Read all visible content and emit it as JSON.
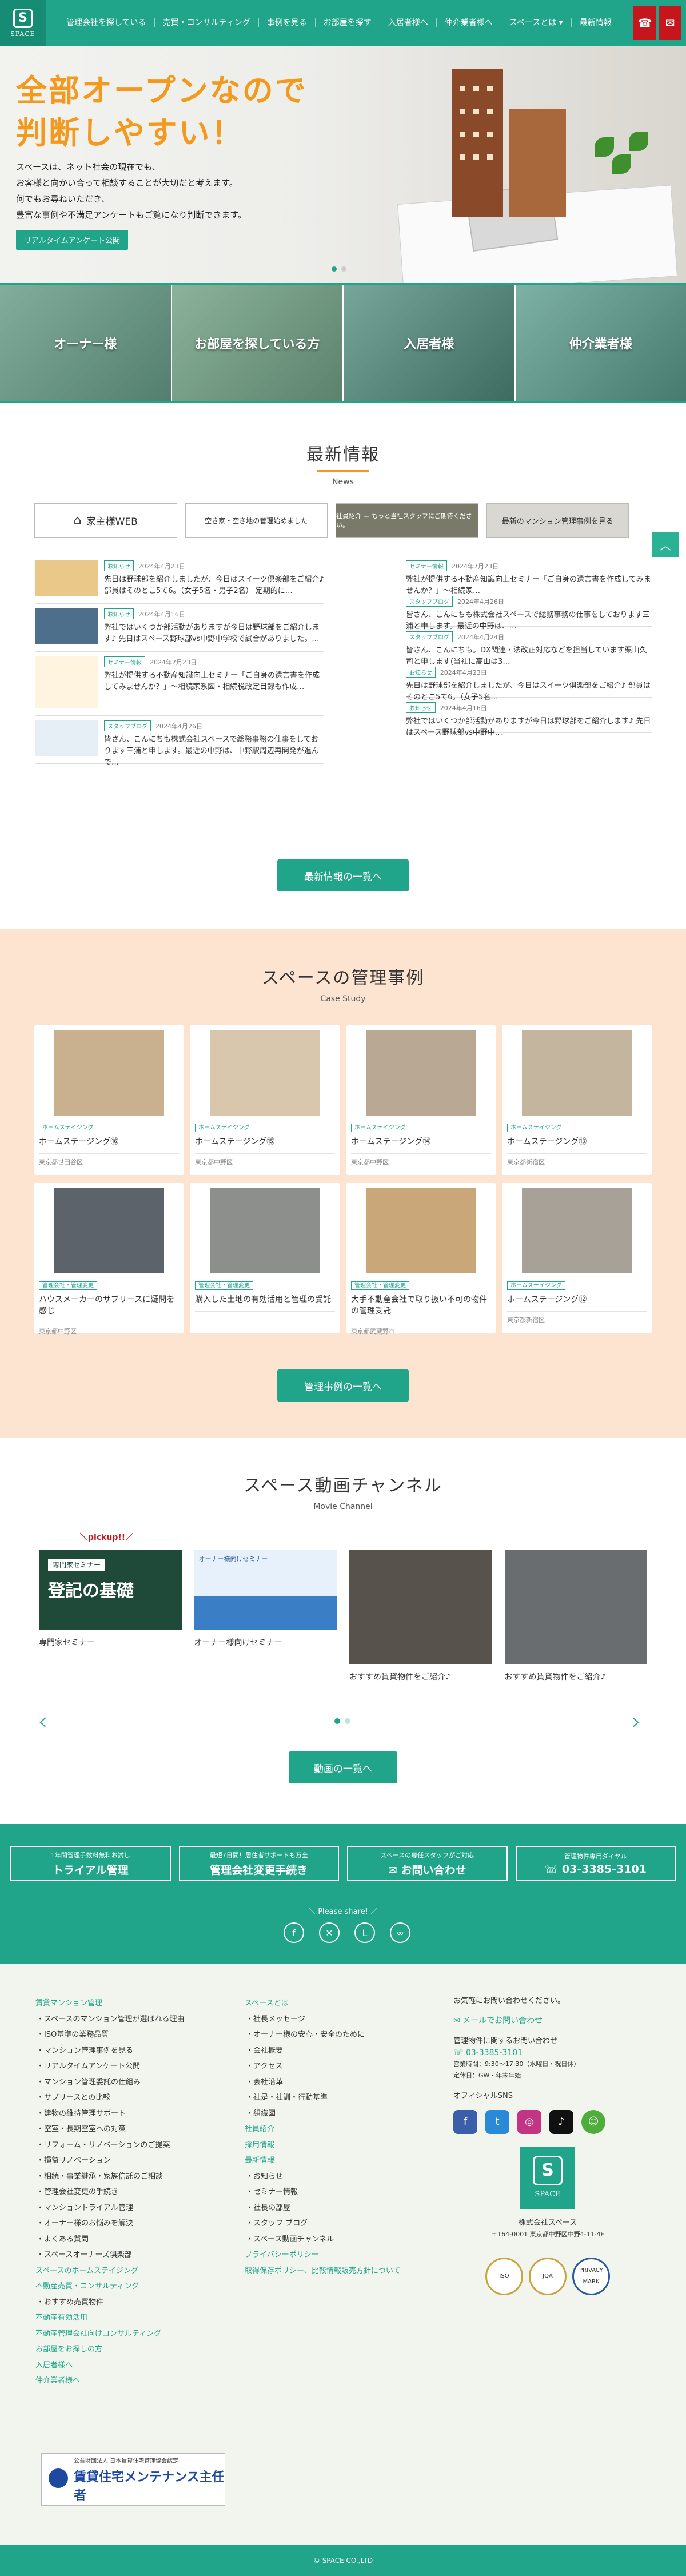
{
  "header": {
    "logo_text": "SPACE",
    "logo_mark": "S",
    "nav": [
      "管理会社を探している",
      "売買・コンサルティング",
      "事例を見る",
      "お部屋を探す",
      "入居者様へ",
      "仲介業者様へ",
      "スペースとは ▾",
      "最新情報"
    ],
    "icons": [
      "phone-icon",
      "mail-icon"
    ]
  },
  "hero": {
    "title_line1": "全部オープンなので",
    "title_line2": "判断しやすい！",
    "desc": [
      "スペースは、ネット社会の現在でも、",
      "お客様と向かい合って相談することが大切だと考えます。",
      "何でもお尋ねいただき、",
      "豊富な事例や不満足アンケートもご覧になり判断できます。"
    ],
    "cta": "リアルタイムアンケート公開"
  },
  "audience": [
    "オーナー様",
    "お部屋を探している方",
    "入居者様",
    "仲介業者様"
  ],
  "news": {
    "title": "最新情報",
    "subtitle": "News",
    "banners": [
      "家主様WEB",
      "空き家・空き地の管理始めました",
      "社員紹介 — もっと当社スタッフにご期待ください。",
      "最新のマンション管理事例を見る"
    ],
    "left": [
      {
        "tag": "お知らせ",
        "date": "2024年4月23日",
        "text": "先日は野球部を紹介しましたが、今日はスイーツ倶楽部をご紹介♪ 部員はそのとこ5て6。（女子5名・男子2名） 定期的に…"
      },
      {
        "tag": "お知らせ",
        "date": "2024年4月16日",
        "text": "弊社ではいくつか部活動がありますが今日は野球部をご紹介します♪ 先日はスペース野球部vs中野中学校で試合がありました。…"
      },
      {
        "tag": "セミナー情報",
        "date": "2024年7月23日",
        "text": "弊社が提供する不動産知識向上セミナー「ご自身の遺言書を作成してみませんか？」～相続家系図・相続税改定目録も作成…"
      },
      {
        "tag": "スタッフブログ",
        "date": "2024年4月26日",
        "text": "皆さん、こんにちも株式会社スペースで総務事務の仕事をしております三浦と申します。最近の中野は、中野駅周辺再開発が進んで…"
      }
    ],
    "right": [
      {
        "tag": "セミナー情報",
        "date": "2024年7月23日",
        "text": "弊社が提供する不動産知識向上セミナー「ご自身の遺言書を作成してみませんか？」～相続家…"
      },
      {
        "tag": "スタッフブログ",
        "date": "2024年4月26日",
        "text": "皆さん、こんにちも株式会社スペースで総務事務の仕事をしております三浦と申します。最近の中野は、…"
      },
      {
        "tag": "スタッフブログ",
        "date": "2024年4月24日",
        "text": "皆さん、こんにちも。DX関連・法改正対応などを担当しています栗山久司と申します(当社に高山は3…"
      },
      {
        "tag": "お知らせ",
        "date": "2024年4月23日",
        "text": "先日は野球部を紹介しましたが、今日はスイーツ倶楽部をご紹介♪ 部員はそのとこ5て6。（女子5名…"
      },
      {
        "tag": "お知らせ",
        "date": "2024年4月16日",
        "text": "弊社ではいくつか部活動がありますが今日は野球部をご紹介します♪ 先日はスペース野球部vs中野中…"
      }
    ],
    "more": "最新情報の一覧へ"
  },
  "cases": {
    "title": "スペースの管理事例",
    "subtitle": "Case Study",
    "items": [
      {
        "tag": "ホームステイジング",
        "title": "ホームステージング⑯",
        "loc": "東京都世田谷区"
      },
      {
        "tag": "ホームステイジング",
        "title": "ホームステージング⑮",
        "loc": "東京都中野区"
      },
      {
        "tag": "ホームステイジング",
        "title": "ホームステージング⑭",
        "loc": "東京都中野区"
      },
      {
        "tag": "ホームステイジング",
        "title": "ホームステージング⑬",
        "loc": "東京都新宿区"
      },
      {
        "tag": "管理会社・管理変更",
        "title": "ハウスメーカーのサブリースに疑問を感じ",
        "loc": "東京都中野区"
      },
      {
        "tag": "管理会社・管理変更",
        "title": "購入した土地の有効活用と管理の受託",
        "loc": ""
      },
      {
        "tag": "管理会社・管理変更",
        "title": "大手不動産会社で取り扱い不可の物件の管理受託",
        "loc": "東京都武蔵野市"
      },
      {
        "tag": "ホームステイジング",
        "title": "ホームステージング⑫",
        "loc": "東京都新宿区"
      }
    ],
    "more": "管理事例の一覧へ"
  },
  "movies": {
    "title": "スペース動画チャンネル",
    "subtitle": "Movie Channel",
    "pickup": "＼pickup!!／",
    "items": [
      {
        "title": "専門家セミナー",
        "thumb_line1": "専門家セミナー",
        "thumb_line2": "登記の基礎"
      },
      {
        "title": "オーナー様向けセミナー",
        "thumb_line1": "オーナー様向けセミナー",
        "thumb_line2": ""
      },
      {
        "title": "おすすめ賃貸物件をご紹介♪",
        "thumb_line1": "",
        "thumb_line2": ""
      },
      {
        "title": "おすすめ賃貸物件をご紹介♪",
        "thumb_line1": "",
        "thumb_line2": ""
      }
    ],
    "more": "動画の一覧へ"
  },
  "contact": {
    "buttons": [
      {
        "small": "1年間管理手数料無料お試し",
        "big": "トライアル管理"
      },
      {
        "small": "最短7日間！居住者サポートも万全",
        "big": "管理会社変更手続き"
      },
      {
        "small": "スペースの専任スタッフがご対応",
        "big": "✉ お問い合わせ"
      },
      {
        "small": "管理物件専用ダイヤル",
        "big": "☏ 03-3385-3101"
      }
    ],
    "share": "＼ Please share! ／"
  },
  "footer": {
    "col1": [
      {
        "t": "h",
        "v": "賃貸マンション管理"
      },
      {
        "t": "s",
        "v": "スペースのマンション管理が選ばれる理由"
      },
      {
        "t": "s",
        "v": "ISO基準の業務品質"
      },
      {
        "t": "s",
        "v": "マンション管理事例を見る"
      },
      {
        "t": "s",
        "v": "リアルタイムアンケート公開"
      },
      {
        "t": "s",
        "v": "マンション管理委託の仕組み"
      },
      {
        "t": "s",
        "v": "サブリースとの比較"
      },
      {
        "t": "s",
        "v": "建物の維持管理サポート"
      },
      {
        "t": "s",
        "v": "空室・長期空室への対策"
      },
      {
        "t": "s",
        "v": "リフォーム・リノベーションのご提案"
      },
      {
        "t": "s",
        "v": "損益リノベーション"
      },
      {
        "t": "s",
        "v": "相続・事業継承・家族信託のご相談"
      },
      {
        "t": "s",
        "v": "管理会社変更の手続き"
      },
      {
        "t": "s",
        "v": "マンショントライアル管理"
      },
      {
        "t": "s",
        "v": "オーナー様のお悩みを解決"
      },
      {
        "t": "s",
        "v": "よくある質問"
      },
      {
        "t": "s",
        "v": "スペースオーナーズ倶楽部"
      },
      {
        "t": "h",
        "v": "スペースのホームステイジング"
      },
      {
        "t": "h",
        "v": "不動産売買・コンサルティング"
      },
      {
        "t": "s",
        "v": "おすすめ売買物件"
      },
      {
        "t": "h",
        "v": "不動産有効活用"
      },
      {
        "t": "h",
        "v": "不動産管理会社向けコンサルティング"
      },
      {
        "t": "h",
        "v": "お部屋をお探しの方"
      },
      {
        "t": "h",
        "v": "入居者様へ"
      },
      {
        "t": "h",
        "v": "仲介業者様へ"
      }
    ],
    "col2": [
      {
        "t": "h",
        "v": "スペースとは"
      },
      {
        "t": "s",
        "v": "社長メッセージ"
      },
      {
        "t": "s",
        "v": "オーナー様の安心・安全のために"
      },
      {
        "t": "s",
        "v": "会社概要"
      },
      {
        "t": "s",
        "v": "アクセス"
      },
      {
        "t": "s",
        "v": "会社沿革"
      },
      {
        "t": "s",
        "v": "社是・社訓・行動基準"
      },
      {
        "t": "s",
        "v": "組織図"
      },
      {
        "t": "h",
        "v": "社員紹介"
      },
      {
        "t": "h",
        "v": "採用情報"
      },
      {
        "t": "h",
        "v": "最新情報"
      },
      {
        "t": "s",
        "v": "お知らせ"
      },
      {
        "t": "s",
        "v": "セミナー情報"
      },
      {
        "t": "s",
        "v": "社長の部屋"
      },
      {
        "t": "s",
        "v": "スタッフ ブログ"
      },
      {
        "t": "s",
        "v": "スペース動画チャンネル"
      },
      {
        "t": "h",
        "v": "プライバシーポリシー"
      },
      {
        "t": "h",
        "v": "取得保存ポリシー、比較情報販売方針について"
      }
    ],
    "info": {
      "inquiry": "お気軽にお問い合わせください。",
      "mail": "✉ メールでお問い合わせ",
      "dial_label": "管理物件に関するお問い合わせ",
      "dial": "☏ 03-3385-3101",
      "hours": "営業時間：9:30〜17:30（水曜日・祝日休）",
      "closed": "定休日：GW・年末年始",
      "sns_label": "オフィシャルSNS",
      "logo_mark": "S",
      "logo_text": "SPACE",
      "company": "株式会社スペース",
      "address": "〒164-0001 東京都中野区中野4-11-4F",
      "badge1": "ISO",
      "badge2": "JQA",
      "badge3": "PRIVACY MARK"
    },
    "cert_small": "公益財団法人 日本賃貸住宅管理協会認定",
    "cert_big": "賃貸住宅メンテナンス主任者"
  },
  "copyright": "© SPACE CO.,LTD",
  "colors": {
    "brand": "#20a58a",
    "accent": "#f39a1e",
    "red": "#c4161c",
    "peach": "#fde4d1"
  }
}
